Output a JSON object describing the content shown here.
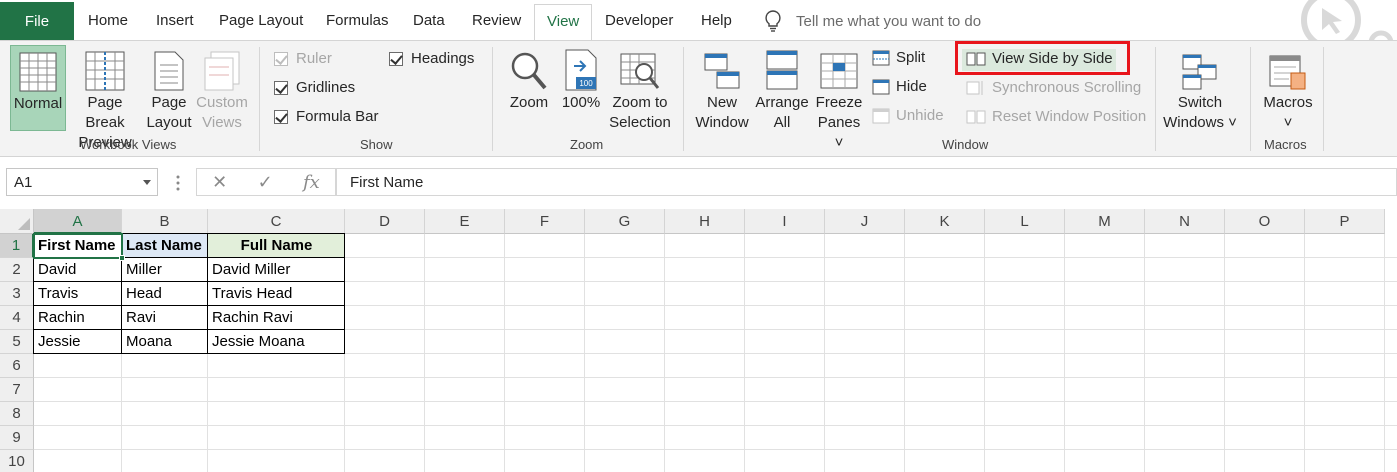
{
  "tabs": {
    "file": "File",
    "items": [
      "Home",
      "Insert",
      "Page Layout",
      "Formulas",
      "Data",
      "Review",
      "View",
      "Developer",
      "Help"
    ],
    "active": "View",
    "tell_me": "Tell me what you want to do"
  },
  "ribbon": {
    "workbook_views": {
      "label": "Workbook Views",
      "normal": "Normal",
      "page_break_1": "Page Break",
      "page_break_2": "Preview",
      "page_layout_1": "Page",
      "page_layout_2": "Layout",
      "custom_1": "Custom",
      "custom_2": "Views"
    },
    "show": {
      "label": "Show",
      "ruler": "Ruler",
      "gridlines": "Gridlines",
      "formula_bar": "Formula Bar",
      "headings": "Headings"
    },
    "zoom": {
      "label": "Zoom",
      "zoom": "Zoom",
      "hundred": "100%",
      "hundred_icon": "100",
      "zoom_sel_1": "Zoom to",
      "zoom_sel_2": "Selection"
    },
    "window": {
      "label": "Window",
      "new_1": "New",
      "new_2": "Window",
      "arrange_1": "Arrange",
      "arrange_2": "All",
      "freeze_1": "Freeze",
      "freeze_2": "Panes ˅",
      "split": "Split",
      "hide": "Hide",
      "unhide": "Unhide",
      "view_side": "View Side by Side",
      "sync_scroll": "Synchronous Scrolling",
      "reset_pos": "Reset Window Position",
      "switch_1": "Switch",
      "switch_2": "Windows ˅"
    },
    "macros": {
      "label": "Macros",
      "macros": "Macros",
      "arrow": "˅"
    }
  },
  "formula_bar": {
    "name_box": "A1",
    "cancel": "✕",
    "enter": "✓",
    "fx": "fx",
    "content": "First Name"
  },
  "grid": {
    "columns": [
      "A",
      "B",
      "C",
      "D",
      "E",
      "F",
      "G",
      "H",
      "I",
      "J",
      "K",
      "L",
      "M",
      "N",
      "O",
      "P"
    ],
    "rows": [
      "1",
      "2",
      "3",
      "4",
      "5",
      "6",
      "7",
      "8",
      "9",
      "10"
    ],
    "headers": [
      "First Name",
      "Last Name",
      "Full Name"
    ],
    "data": [
      [
        "David",
        "Miller",
        "David Miller"
      ],
      [
        "Travis",
        "Head",
        "Travis Head"
      ],
      [
        "Rachin",
        "Ravi",
        "Rachin Ravi"
      ],
      [
        "Jessie",
        "Moana",
        "Jessie Moana"
      ]
    ]
  },
  "colors": {
    "accent": "#217346",
    "highlight_box": "#e8141b",
    "header_c_fill": "#e2efda",
    "header_b_fill": "#dde8f5"
  }
}
